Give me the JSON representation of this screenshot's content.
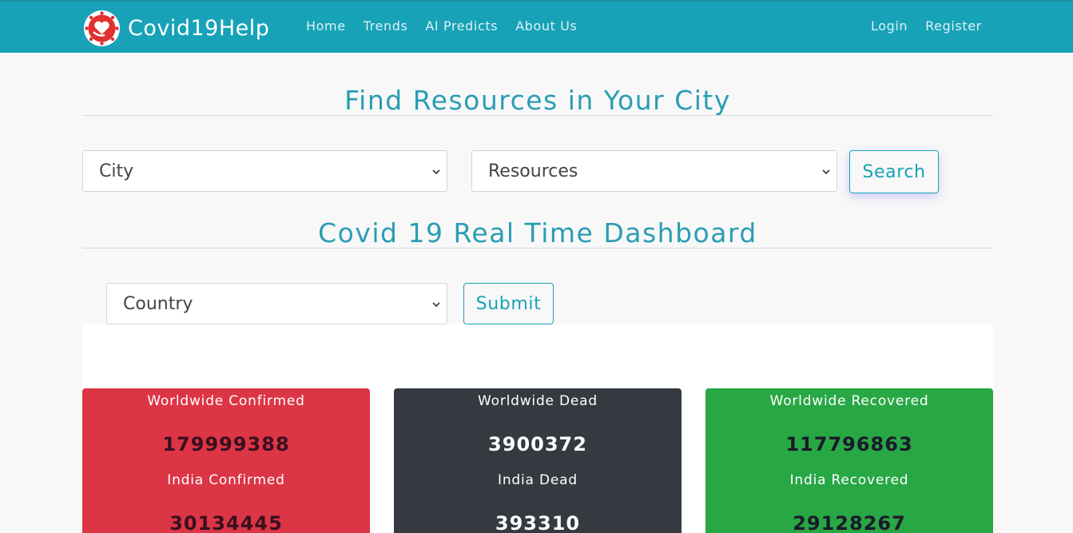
{
  "navbar": {
    "brand": "Covid19Help",
    "links": [
      "Home",
      "Trends",
      "AI Predicts",
      "About Us"
    ],
    "right_links": [
      "Login",
      "Register"
    ],
    "bg_color": "#17a2b8"
  },
  "resources": {
    "title": "Find Resources in Your City",
    "city_select": "City",
    "resource_select": "Resources",
    "search_label": "Search"
  },
  "dashboard": {
    "title": "Covid 19 Real Time Dashboard",
    "country_select": "Country",
    "submit_label": "Submit",
    "cards": [
      {
        "world_label": "Worldwide Confirmed",
        "world_value": "179999388",
        "india_label": "India Confirmed",
        "india_value": "30134445",
        "color": "#dc3545"
      },
      {
        "world_label": "Worldwide Dead",
        "world_value": "3900372",
        "india_label": "India Dead",
        "india_value": "393310",
        "color": "#343a40"
      },
      {
        "world_label": "Worldwide Recovered",
        "world_value": "117796863",
        "india_label": "India Recovered",
        "india_value": "29128267",
        "color": "#28a745"
      }
    ]
  }
}
